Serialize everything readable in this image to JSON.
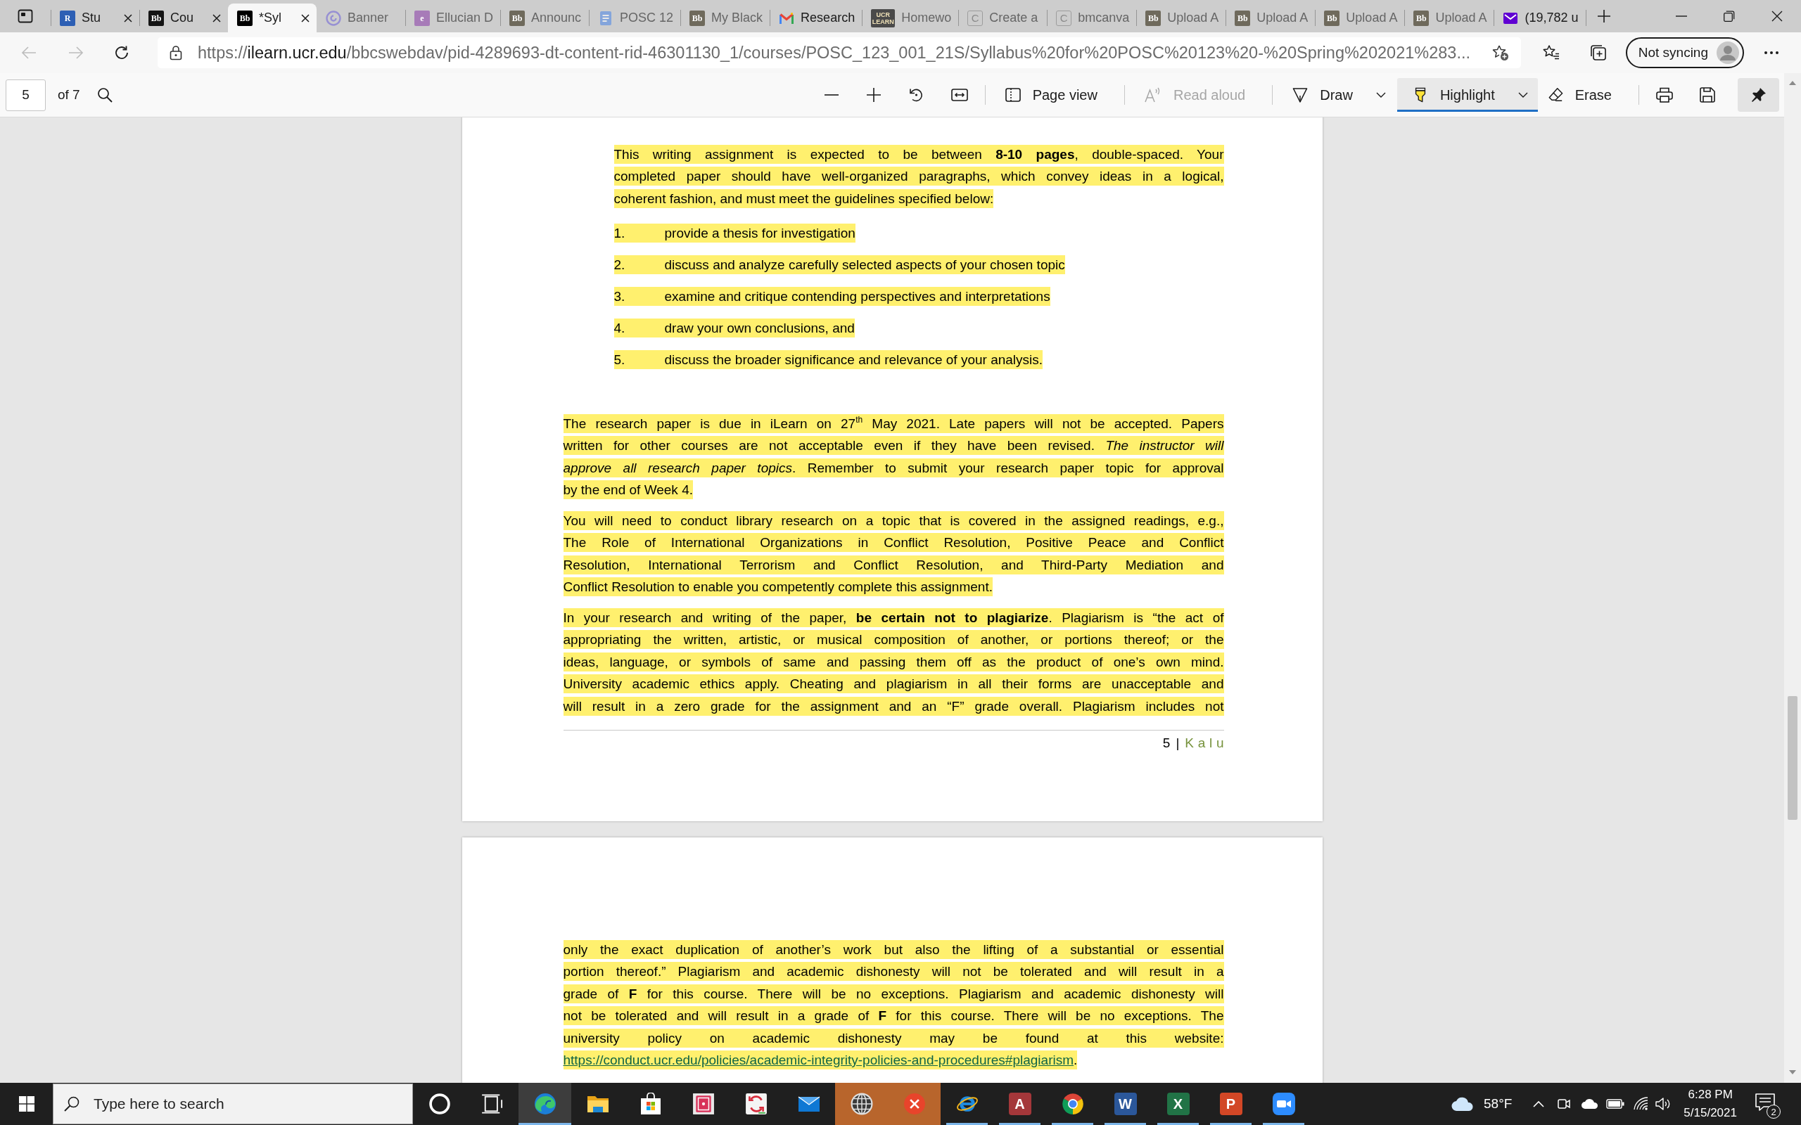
{
  "browser": {
    "tabs": [
      {
        "title": "Stu",
        "kind": "monogram",
        "logo_text": "R",
        "color": "#2d5fb4",
        "selected": false,
        "sleeping": false,
        "show_close": true
      },
      {
        "title": "Cou",
        "kind": "monogram",
        "logo_text": "Bb",
        "color": "#151515",
        "selected": false,
        "sleeping": false,
        "show_close": true
      },
      {
        "title": "*Syl",
        "kind": "monogram",
        "logo_text": "Bb",
        "color": "#000000",
        "selected": true,
        "sleeping": false,
        "show_close": true
      },
      {
        "title": "Banner",
        "kind": "ring",
        "selected": false,
        "sleeping": true,
        "show_close": false
      },
      {
        "title": "Ellucian D",
        "kind": "monogram",
        "logo_text": "e",
        "color": "#a77bb8",
        "selected": false,
        "sleeping": true,
        "show_close": false
      },
      {
        "title": "Announc",
        "kind": "monogram",
        "logo_text": "Bb",
        "color": "#6f6a5c",
        "selected": false,
        "sleeping": true,
        "show_close": false
      },
      {
        "title": "POSC 12",
        "kind": "document",
        "selected": false,
        "sleeping": true,
        "show_close": false
      },
      {
        "title": "My Black",
        "kind": "monogram",
        "logo_text": "Bb",
        "color": "#6f6a5c",
        "selected": false,
        "sleeping": true,
        "show_close": false
      },
      {
        "title": "Research",
        "kind": "envelope",
        "selected": false,
        "sleeping": false,
        "show_close": false
      },
      {
        "title": "Homewo",
        "kind": "monogram",
        "logo_text": "UCR LEARN",
        "color": "#4a4a4a",
        "selected": false,
        "sleeping": true,
        "show_close": false
      },
      {
        "title": "Create a",
        "kind": "outline",
        "logo_text": "C",
        "selected": false,
        "sleeping": true,
        "show_close": false
      },
      {
        "title": "bmcanva",
        "kind": "outline",
        "logo_text": "C",
        "selected": false,
        "sleeping": true,
        "show_close": false
      },
      {
        "title": "Upload A",
        "kind": "monogram",
        "logo_text": "Bb",
        "color": "#6f6a5c",
        "selected": false,
        "sleeping": true,
        "show_close": false
      },
      {
        "title": "Upload A",
        "kind": "monogram",
        "logo_text": "Bb",
        "color": "#6f6a5c",
        "selected": false,
        "sleeping": true,
        "show_close": false
      },
      {
        "title": "Upload A",
        "kind": "monogram",
        "logo_text": "Bb",
        "color": "#6f6a5c",
        "selected": false,
        "sleeping": true,
        "show_close": false
      },
      {
        "title": "Upload A",
        "kind": "monogram",
        "logo_text": "Bb",
        "color": "#6f6a5c",
        "selected": false,
        "sleeping": true,
        "show_close": false
      },
      {
        "title": "(19,782 u",
        "kind": "mailtile",
        "selected": false,
        "sleeping": false,
        "show_close": false
      }
    ]
  },
  "address_bar": {
    "back": {
      "disabled": true
    },
    "forward": {
      "disabled": true
    },
    "url_scheme": "https://",
    "url_host": "ilearn.ucr.edu",
    "url_path": "/bbcswebdav/pid-4289693-dt-content-rid-46301130_1/courses/POSC_123_001_21S/Syllabus%20for%20POSC%20123%20-%20Spring%202021%283...",
    "sync_label": "Not syncing"
  },
  "pdf_toolbar": {
    "page_number": "5",
    "page_total": "of 7",
    "page_view": "Page view",
    "read_aloud": {
      "label": "Read aloud",
      "disabled": true
    },
    "tools": [
      {
        "kind": "draw",
        "label": "Draw",
        "selected": false,
        "has_menu": true
      },
      {
        "kind": "highlight",
        "label": "Highlight",
        "selected": true,
        "has_menu": true
      },
      {
        "kind": "erase",
        "label": "Erase",
        "selected": false,
        "has_menu": false
      }
    ],
    "pinned": true
  },
  "document": {
    "pages": [
      {
        "blocks": [
          {
            "kind": "paragraph",
            "indented": true,
            "continues": false,
            "lines": [
              "This writing assignment is expected to be between **8-10 pages**, double-spaced. Your",
              "completed paper should have well-organized paragraphs, which convey ideas in a logical,",
              "coherent fashion, and must meet the guidelines specified below:"
            ]
          },
          {
            "kind": "numbered_list",
            "items": [
              {
                "number": "1.",
                "text": "provide a thesis for investigation"
              },
              {
                "number": "2.",
                "text": "discuss and analyze carefully selected aspects of your chosen topic"
              },
              {
                "number": "3.",
                "text": "examine and critique contending perspectives and interpretations"
              },
              {
                "number": "4.",
                "text": "draw your own conclusions, and"
              },
              {
                "number": "5.",
                "text": "discuss the broader significance and relevance of your analysis."
              }
            ]
          },
          {
            "kind": "paragraph",
            "indented": false,
            "continues": false,
            "lines": [
              "The research paper is due in iLearn on 27$^{th}$ May 2021. Late papers will not be accepted. Papers",
              "written for other courses are not acceptable even if they have been revised. *The instructor will*",
              "*approve all research paper topics*. Remember to submit your research paper topic for approval",
              "by the end of Week 4."
            ]
          },
          {
            "kind": "paragraph",
            "indented": false,
            "continues": false,
            "lines": [
              "You will need to conduct library research on a topic that is covered in the assigned readings, e.g.,",
              "The Role of International Organizations in Conflict Resolution, Positive Peace and Conflict",
              "Resolution, International Terrorism and Conflict Resolution, and Third-Party Mediation and",
              "Conflict Resolution to enable you competently complete this assignment."
            ]
          },
          {
            "kind": "paragraph",
            "indented": false,
            "continues": true,
            "lines": [
              "In your research and writing of the paper, **be certain not to plagiarize**. Plagiarism is “the act of",
              "appropriating the written, artistic, or musical composition of another, or portions thereof; or the",
              "ideas, language, or symbols of same and passing them off as the product of one’s own mind.",
              "University academic ethics apply. Cheating and plagiarism in all their forms are unacceptable and",
              "will result in a zero grade for the assignment and an “F” grade overall. Plagiarism includes not"
            ]
          }
        ],
        "footer": {
          "page_number": "5",
          "separator": "|",
          "author": "Kalu"
        }
      },
      {
        "blocks": [
          {
            "kind": "paragraph",
            "indented": false,
            "lines": [
              "only the exact duplication of another’s work but also the lifting of a substantial or essential",
              "portion thereof.” Plagiarism and academic dishonesty will not be tolerated and will result in a",
              "grade of **F** for this course. There will be no exceptions. Plagiarism and academic dishonesty will",
              "not be tolerated and will result in a grade of **F** for this course. There will be no exceptions. The",
              "university policy on academic dishonesty may be found at this website:"
            ],
            "link": "https://conduct.ucr.edu/policies/academic-integrity-policies-and-procedures#plagiarism",
            "link_suffix": "."
          }
        ]
      }
    ]
  },
  "taskbar": {
    "search": {
      "placeholder": "Type here to search"
    },
    "apps": [
      {
        "kind": "edge",
        "running": true,
        "selected": true,
        "flashing": false
      },
      {
        "kind": "folder",
        "running": false,
        "selected": false,
        "flashing": false
      },
      {
        "kind": "store",
        "running": false,
        "selected": false,
        "flashing": false
      },
      {
        "kind": "book",
        "running": false,
        "selected": false,
        "flashing": false
      },
      {
        "kind": "sync",
        "running": false,
        "selected": false,
        "flashing": false
      },
      {
        "kind": "mail",
        "running": false,
        "selected": false,
        "flashing": false
      },
      {
        "kind": "globe",
        "running": false,
        "selected": false,
        "flashing": true
      },
      {
        "kind": "x-circle",
        "running": false,
        "selected": false,
        "flashing": true
      },
      {
        "kind": "orbit",
        "running": true,
        "selected": false,
        "flashing": false
      },
      {
        "kind": "letter",
        "label": "A",
        "color": "#a4373a",
        "running": true,
        "selected": false,
        "flashing": false
      },
      {
        "kind": "ring",
        "running": true,
        "selected": false,
        "flashing": false
      },
      {
        "kind": "letter",
        "label": "W",
        "color": "#2b579a",
        "running": true,
        "selected": false,
        "flashing": false
      },
      {
        "kind": "letter",
        "label": "X",
        "color": "#217346",
        "running": true,
        "selected": false,
        "flashing": false
      },
      {
        "kind": "letter",
        "label": "P",
        "color": "#d24726",
        "running": true,
        "selected": false,
        "flashing": false
      },
      {
        "kind": "camera",
        "running": true,
        "selected": false,
        "flashing": false
      }
    ],
    "temperature": "58°F",
    "time": "6:28 PM",
    "date": "5/15/2021",
    "notification_count": "2"
  }
}
